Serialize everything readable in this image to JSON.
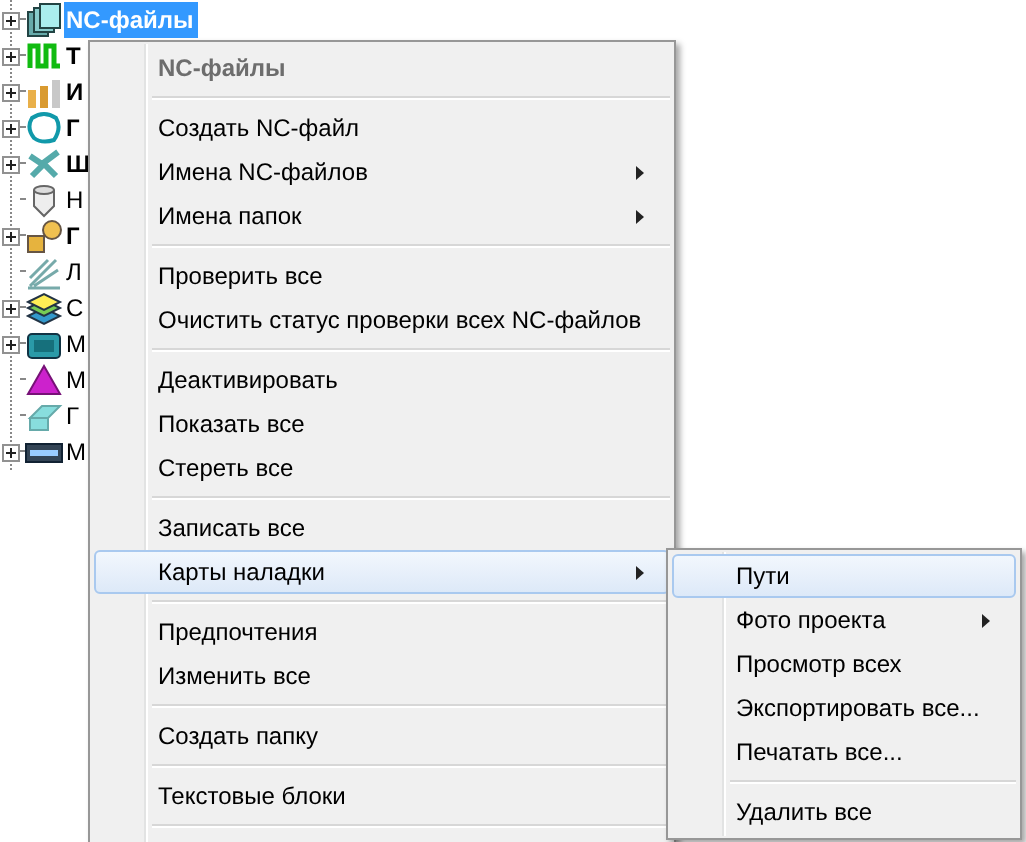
{
  "tree": {
    "items": [
      {
        "label": "NC-файлы",
        "expandable": true,
        "bold": true,
        "selected": true
      },
      {
        "label": "Т",
        "expandable": true,
        "bold": true,
        "selected": false
      },
      {
        "label": "И",
        "expandable": true,
        "bold": true,
        "selected": false
      },
      {
        "label": "Г",
        "expandable": true,
        "bold": true,
        "selected": false
      },
      {
        "label": "Ш",
        "expandable": true,
        "bold": true,
        "selected": false
      },
      {
        "label": "Н",
        "expandable": false,
        "bold": false,
        "selected": false
      },
      {
        "label": "Г",
        "expandable": true,
        "bold": true,
        "selected": false
      },
      {
        "label": "Л",
        "expandable": false,
        "bold": false,
        "selected": false
      },
      {
        "label": "С",
        "expandable": true,
        "bold": false,
        "selected": false
      },
      {
        "label": "М",
        "expandable": true,
        "bold": false,
        "selected": false
      },
      {
        "label": "М",
        "expandable": false,
        "bold": false,
        "selected": false
      },
      {
        "label": "Г",
        "expandable": false,
        "bold": false,
        "selected": false
      },
      {
        "label": "М",
        "expandable": true,
        "bold": false,
        "selected": false
      }
    ]
  },
  "context_menu": {
    "items": [
      {
        "kind": "header",
        "label": "NC-файлы"
      },
      {
        "kind": "separator"
      },
      {
        "kind": "item",
        "label": "Создать NC-файл",
        "submenu": false,
        "selected": false
      },
      {
        "kind": "item",
        "label": "Имена NC-файлов",
        "submenu": true,
        "selected": false
      },
      {
        "kind": "item",
        "label": "Имена папок",
        "submenu": true,
        "selected": false
      },
      {
        "kind": "separator"
      },
      {
        "kind": "item",
        "label": "Проверить все",
        "submenu": false,
        "selected": false
      },
      {
        "kind": "item",
        "label": "Очистить статус проверки всех NC-файлов",
        "submenu": false,
        "selected": false
      },
      {
        "kind": "separator"
      },
      {
        "kind": "item",
        "label": "Деактивировать",
        "submenu": false,
        "selected": false
      },
      {
        "kind": "item",
        "label": "Показать все",
        "submenu": false,
        "selected": false
      },
      {
        "kind": "item",
        "label": "Стереть все",
        "submenu": false,
        "selected": false
      },
      {
        "kind": "separator"
      },
      {
        "kind": "item",
        "label": "Записать все",
        "submenu": false,
        "selected": false
      },
      {
        "kind": "item",
        "label": "Карты наладки",
        "submenu": true,
        "selected": true
      },
      {
        "kind": "separator"
      },
      {
        "kind": "item",
        "label": "Предпочтения",
        "submenu": false,
        "selected": false
      },
      {
        "kind": "item",
        "label": "Изменить все",
        "submenu": false,
        "selected": false
      },
      {
        "kind": "separator"
      },
      {
        "kind": "item",
        "label": "Создать папку",
        "submenu": false,
        "selected": false
      },
      {
        "kind": "separator"
      },
      {
        "kind": "item",
        "label": "Текстовые блоки",
        "submenu": false,
        "selected": false
      },
      {
        "kind": "separator"
      }
    ]
  },
  "submenu": {
    "items": [
      {
        "kind": "item",
        "label": "Пути",
        "submenu": false,
        "selected": true
      },
      {
        "kind": "item",
        "label": "Фото проекта",
        "submenu": true,
        "selected": false
      },
      {
        "kind": "item",
        "label": "Просмотр всех",
        "submenu": false,
        "selected": false
      },
      {
        "kind": "item",
        "label": "Экспортировать все...",
        "submenu": false,
        "selected": false
      },
      {
        "kind": "item",
        "label": "Печатать все...",
        "submenu": false,
        "selected": false
      },
      {
        "kind": "separator"
      },
      {
        "kind": "item",
        "label": "Удалить все",
        "submenu": false,
        "selected": false
      }
    ]
  }
}
